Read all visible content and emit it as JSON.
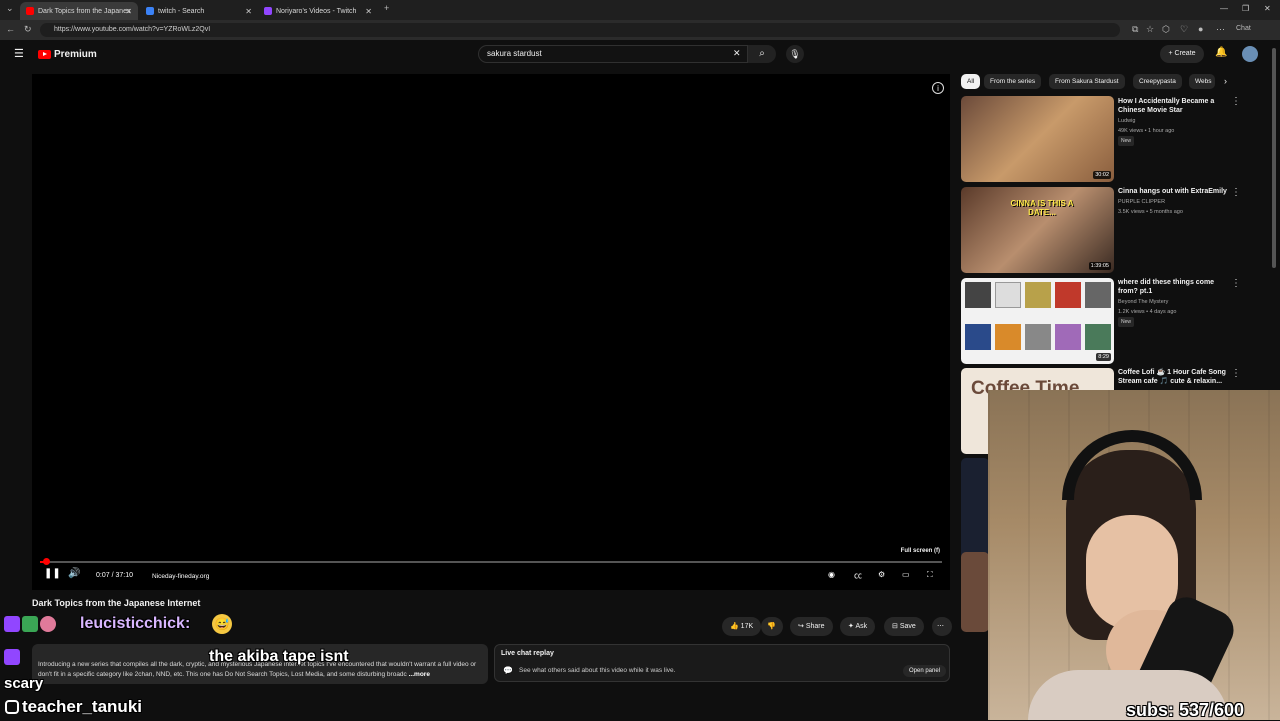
{
  "browser": {
    "tabs": [
      {
        "title": "Dark Topics from the Japanes",
        "active": true,
        "fav_color": "#ff0000"
      },
      {
        "title": "twitch - Search",
        "active": false,
        "fav_color": "#3b82f6"
      },
      {
        "title": "Noriyaro's Videos - Twitch",
        "active": false,
        "fav_color": "#9146ff"
      }
    ],
    "url": "https://www.youtube.com/watch?v=YZRoWLz2QvI",
    "chat_label": "Chat"
  },
  "header": {
    "logo_text": "Premium",
    "search_value": "sakura stardust",
    "create_label": "Create"
  },
  "player": {
    "time": "0:07 / 37:10",
    "chapter": "Niceday-fineday.org",
    "tooltip": "Full screen (f)",
    "progress": 0.003
  },
  "video": {
    "title": "Dark Topics from the Japanese Internet",
    "likes": "17K",
    "share_label": "Share",
    "ask_label": "Ask",
    "save_label": "Save",
    "description": "Introducing a new series that compiles all the dark, cryptic, and mysterious Japanese internet topics I've encountered that wouldn't warrant a full video or don't fit in a specific category like 2chan, NND, etc. This one has Do Not Search Topics, Lost Media, and some disturbing broadc",
    "more_label": "...more"
  },
  "livechat": {
    "title": "Live chat replay",
    "body": "See what others said about this video while it was live.",
    "button": "Open panel"
  },
  "sidebar": {
    "chips": [
      "All",
      "From the series",
      "From Sakura Stardust",
      "Creepypasta",
      "Webs"
    ],
    "videos": [
      {
        "title": "How I Accidentally Became a Chinese Movie Star",
        "channel": "Ludwig",
        "meta": "49K views • 1 hour ago",
        "badge": "New",
        "duration": "30:02"
      },
      {
        "title": "Cinna hangs out with ExtraEmily",
        "channel": "PURPLE CLIPPER",
        "meta": "3.5K views • 5 months ago",
        "badge": "",
        "duration": "1:39:05",
        "thumb_text": "CINNA IS THIS A DATE..."
      },
      {
        "title": "where did these things come from? pt.1",
        "channel": "Beyond The Mystery",
        "meta": "1.2K views • 4 days ago",
        "badge": "New",
        "duration": "8:29"
      },
      {
        "title": "Coffee Lofi ☕ 1 Hour Cafe Song Stream cafe 🎵 cute & relaxin...",
        "channel": "",
        "meta": "",
        "badge": "",
        "duration": "",
        "thumb_text": "Coffee Time"
      }
    ]
  },
  "stream_overlay": {
    "chat_user_1": "leucisticchick:",
    "chat_msg_2": "the akiba tape isnt",
    "chat_msg_2b": "scary",
    "social_handle": "teacher_tanuki",
    "subs": "subs: 537/600"
  }
}
